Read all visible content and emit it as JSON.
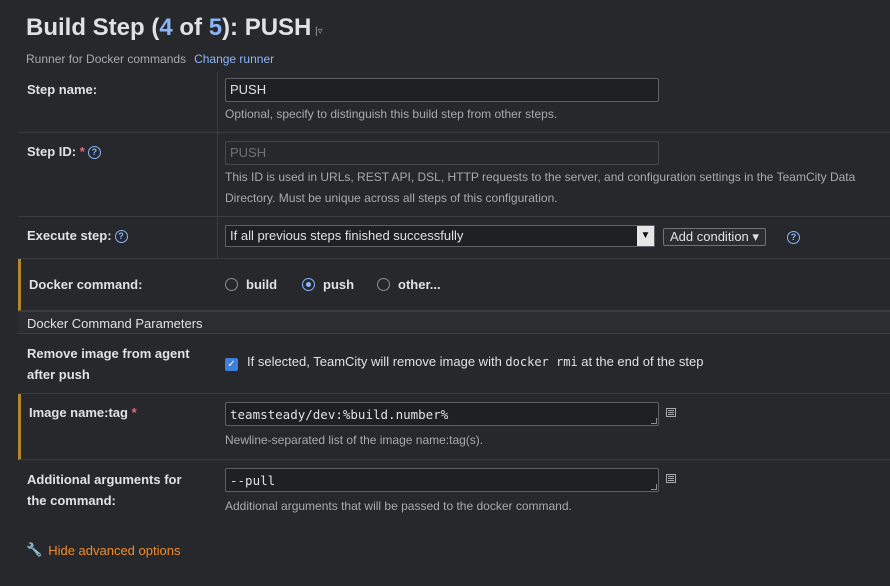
{
  "header": {
    "title_prefix": "Build Step (",
    "step_current": "4",
    "of_text": " of ",
    "step_total": "5",
    "title_suffix": "): PUSH",
    "dropdown_glyph": "|▿",
    "runner_description": "Runner for Docker commands",
    "change_runner_link": "Change runner"
  },
  "step_name": {
    "label": "Step name:",
    "value": "PUSH",
    "hint": "Optional, specify to distinguish this build step from other steps."
  },
  "step_id": {
    "label": "Step ID:",
    "required_mark": "*",
    "help_glyph": "?",
    "placeholder": "PUSH",
    "hint_line1": "This ID is used in URLs, REST API, DSL, HTTP requests to the server, and configuration settings in the TeamCity Data",
    "hint_line2": "Directory. Must be unique across all steps of this configuration."
  },
  "execute_step": {
    "label": "Execute step:",
    "help_glyph": "?",
    "selected": "If all previous steps finished successfully",
    "select_arrow": "▼",
    "add_condition_label": "Add condition",
    "add_condition_caret": "▾",
    "help2_glyph": "?"
  },
  "docker_command": {
    "label": "Docker command:",
    "options": [
      {
        "label": "build",
        "checked": false
      },
      {
        "label": "push",
        "checked": true
      },
      {
        "label": "other...",
        "checked": false
      }
    ]
  },
  "section": {
    "title": "Docker Command Parameters"
  },
  "remove_image": {
    "label_line1": "Remove image from agent",
    "label_line2": "after push",
    "checked": true,
    "check_glyph": "✓",
    "text_before": "If selected, TeamCity will remove image with ",
    "code": "docker rmi",
    "text_after": " at the end of the step"
  },
  "image_tag": {
    "label": "Image name:tag",
    "required_mark": "*",
    "value": "teamsteady/dev:%build.number%",
    "hint": "Newline-separated list of the image name:tag(s)."
  },
  "additional_args": {
    "label_line1": "Additional arguments for",
    "label_line2": "the command:",
    "value": "--pull",
    "hint": "Additional arguments that will be passed to the docker command."
  },
  "footer": {
    "wrench_glyph": "🔧",
    "hide_advanced_label": "Hide advanced options"
  },
  "colors": {
    "background": "#27282c",
    "link": "#8ab4f8",
    "accent_border": "#b1872a",
    "advanced_link": "#f08c2a",
    "required": "#e06c75"
  }
}
